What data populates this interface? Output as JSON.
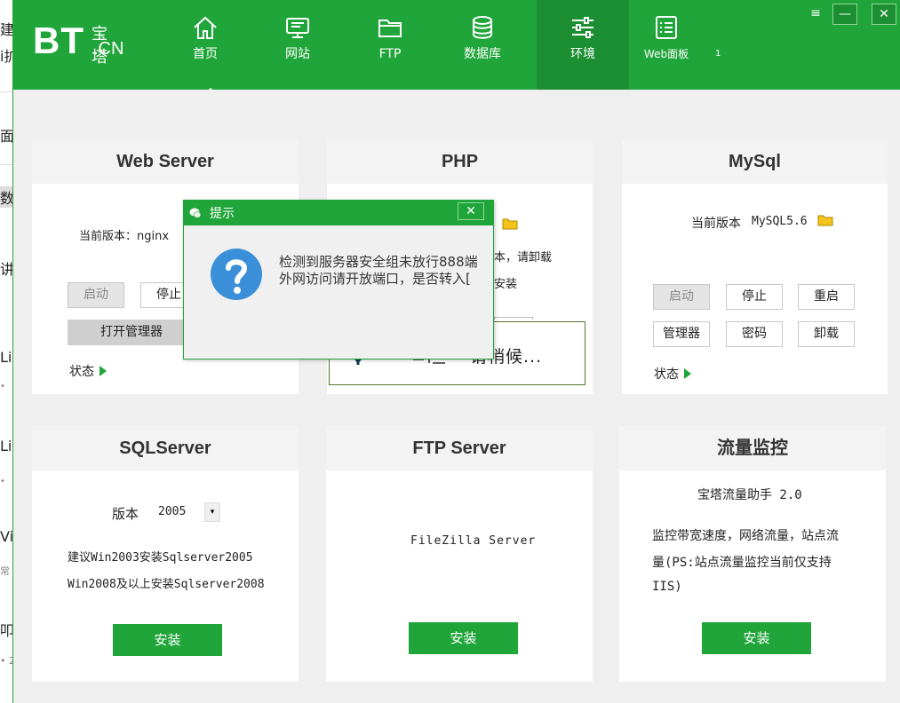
{
  "background_window": {
    "fragments": [
      "建",
      "i扩",
      "面",
      "数",
      "讲",
      "Lir",
      "•",
      "Lir",
      "•",
      "Vi",
      "常",
      "叩",
      "• 2"
    ]
  },
  "app": {
    "logo": {
      "main": "BT",
      "sub_top": "宝塔",
      "sub_bottom": ".CN"
    },
    "nav": [
      {
        "label": "首页",
        "icon": "home-icon"
      },
      {
        "label": "网站",
        "icon": "monitor-icon"
      },
      {
        "label": "FTP",
        "icon": "folder-icon"
      },
      {
        "label": "数据库",
        "icon": "database-icon"
      },
      {
        "label": "环境",
        "icon": "sliders-icon",
        "active": true
      },
      {
        "label": "Web面板",
        "icon": "list-icon"
      }
    ],
    "nav_extra": "1",
    "window_controls": {
      "menu": "≡",
      "minimize": "—",
      "close": "✕"
    }
  },
  "cards": {
    "web_server": {
      "title": "Web Server",
      "version_label": "当前版本：nginx",
      "buttons": {
        "start": "启动",
        "stop": "停止",
        "open_manager": "打开管理器"
      },
      "status": "状态"
    },
    "php": {
      "title": "PHP",
      "partial_text_1": "本，请卸载",
      "partial_text_2": "安装"
    },
    "mysql": {
      "title": "MySql",
      "version_label": "当前版本",
      "version_value": "MySQL5.6",
      "buttons": {
        "start": "启动",
        "stop": "停止",
        "restart": "重启",
        "manager": "管理器",
        "password": "密码",
        "uninstall": "卸载"
      },
      "status": "状态"
    },
    "sqlserver": {
      "title": "SQLServer",
      "version_label": "版本",
      "version_value": "2005",
      "note_1": "建议Win2003安装Sqlserver2005",
      "note_2": "Win2008及以上安装Sqlserver2008",
      "install": "安装"
    },
    "ftp_server": {
      "title": "FTP Server",
      "product": "FileZilla Server",
      "install": "安装"
    },
    "traffic": {
      "title": "流量监控",
      "product": "宝塔流量助手 2.0",
      "desc_1": "监控带宽速度，网络流量，站点流",
      "desc_2": "量(PS:站点流量监控当前仅支持",
      "desc_3": "IIS)",
      "install": "安装"
    }
  },
  "loading": {
    "text": "请稍候..."
  },
  "dialog": {
    "title": "提示",
    "close": "✕",
    "message_line_1": "检测到服务器安全组未放行888端",
    "message_line_2": "外网访问请开放端口，是否转入["
  },
  "colors": {
    "brand_green": "#20a53a",
    "active_nav": "#1b8f31",
    "info_blue": "#3b8fd8"
  }
}
